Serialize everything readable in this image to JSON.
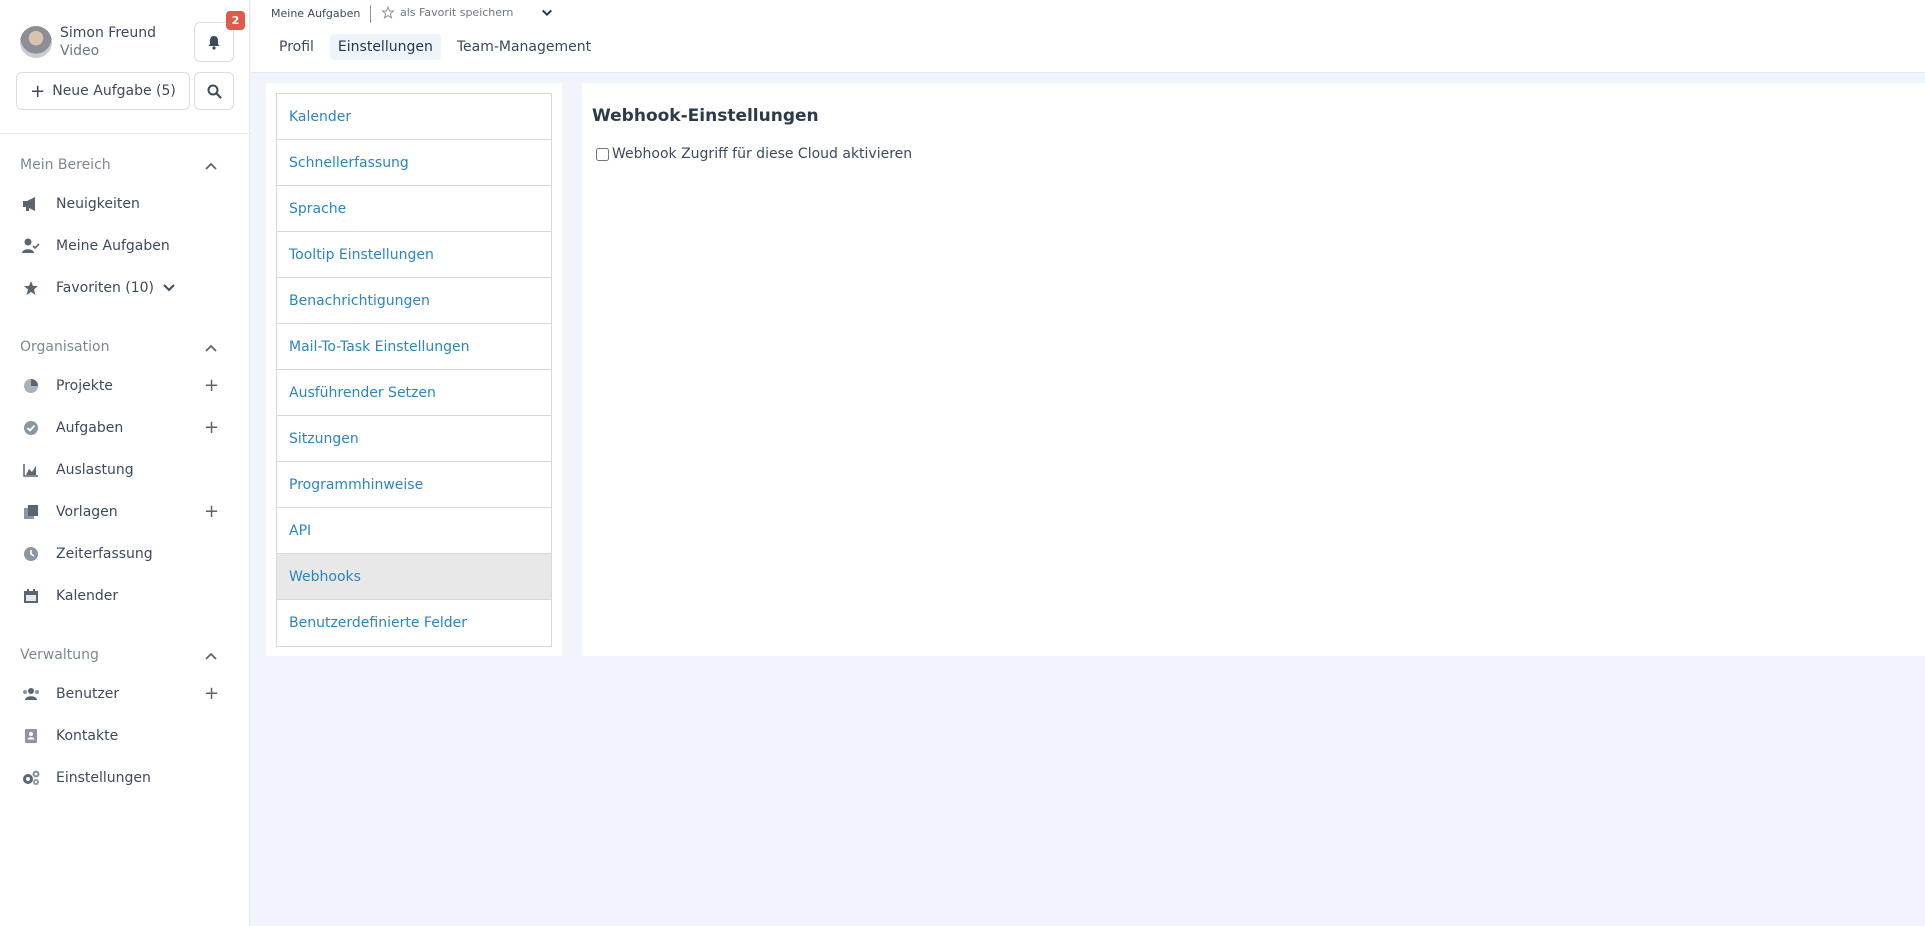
{
  "user": {
    "name": "Simon Freund",
    "sub": "Video"
  },
  "notifications": {
    "count": "2"
  },
  "sidebar": {
    "new_task_label": "Neue Aufgabe (5)",
    "sections": {
      "mein_bereich": "Mein Bereich",
      "organisation": "Organisation",
      "verwaltung": "Verwaltung"
    },
    "items": {
      "neuigkeiten": "Neuigkeiten",
      "meine_aufgaben": "Meine Aufgaben",
      "favoriten": "Favoriten (10)",
      "projekte": "Projekte",
      "aufgaben": "Aufgaben",
      "auslastung": "Auslastung",
      "vorlagen": "Vorlagen",
      "zeiterfassung": "Zeiterfassung",
      "kalender": "Kalender",
      "benutzer": "Benutzer",
      "kontakte": "Kontakte",
      "einstellungen": "Einstellungen"
    }
  },
  "header": {
    "breadcrumb": "Meine Aufgaben",
    "favorite_label": "als Favorit speichern",
    "tabs": [
      "Profil",
      "Einstellungen",
      "Team-Management"
    ],
    "active_tab": "Einstellungen"
  },
  "settings_menu": [
    "Kalender",
    "Schnellerfassung",
    "Sprache",
    "Tooltip Einstellungen",
    "Benachrichtigungen",
    "Mail-To-Task Einstellungen",
    "Ausführender Setzen",
    "Sitzungen",
    "Programmhinweise",
    "API",
    "Webhooks",
    "Benutzerdefinierte Felder"
  ],
  "active_menu_item": "Webhooks",
  "content": {
    "title": "Webhook-Einstellungen",
    "checkbox_label": "Webhook Zugriff für diese Cloud aktivieren",
    "checkbox_checked": false
  },
  "colors": {
    "link": "#2a86c0",
    "badge": "#e05a4b",
    "background": "#f1f5fb"
  }
}
